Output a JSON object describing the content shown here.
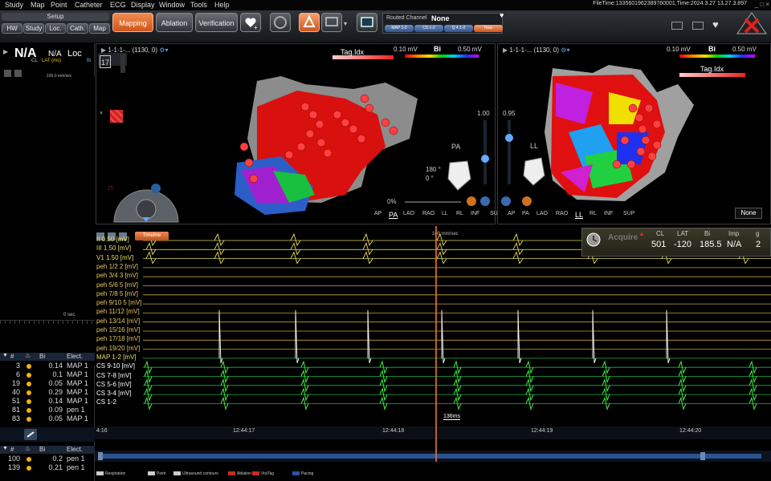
{
  "menu": [
    "Study",
    "Map",
    "Point",
    "Catheter",
    "ECG",
    "Display",
    "Window",
    "Tools",
    "Help"
  ],
  "file_time": "FileTime:1335601962389760001,Time:2024.3.27 13.27.3.897",
  "window_controls": [
    "_",
    "□",
    "×"
  ],
  "toolbar": {
    "setup_label": "Setup",
    "setup_tabs": [
      "HW",
      "Study",
      "Loc.",
      "Cath.",
      "Map"
    ],
    "mapping": "Mapping",
    "ablation": "Ablation",
    "verification": "Verification",
    "routed_channel_label": "Routed Channel",
    "routed_channel_value": "None",
    "routed_channels": [
      "MAP 1-2",
      "CS 1-2",
      "Q 4 1-2",
      "Now"
    ]
  },
  "left": {
    "cl": "N/A",
    "lat": "N/A",
    "loc": "Loc",
    "cl_label": "CL",
    "lat_label": "LAT (ms)",
    "bi_label": "Bi",
    "speed": "100.0 mm/sec",
    "zero": "0 sec",
    "points_header": {
      "c1": "#",
      "c2": "Bi",
      "c3": "Elect."
    },
    "points": [
      {
        "id": "3",
        "bi": "0.14",
        "el": "MAP 1"
      },
      {
        "id": "6",
        "bi": "0.1",
        "el": "MAP 1"
      },
      {
        "id": "19",
        "bi": "0.05",
        "el": "MAP 1"
      },
      {
        "id": "40",
        "bi": "0.29",
        "el": "MAP 1"
      },
      {
        "id": "51",
        "bi": "0.14",
        "el": "MAP 1"
      },
      {
        "id": "81",
        "bi": "0.09",
        "el": "pen 1"
      },
      {
        "id": "83",
        "bi": "0.05",
        "el": "MAP 1"
      }
    ],
    "points2": [
      {
        "id": "100",
        "bi": "0.2",
        "el": "pen 1"
      },
      {
        "id": "139",
        "bi": "0.21",
        "el": "pen 1"
      }
    ],
    "badge": "17"
  },
  "map1": {
    "title": "1-1-1-... (1130, 0)",
    "tag_label": "Tag.Idx",
    "scale_min": "0.10 mV",
    "scale_name": "Bi",
    "scale_max": "0.50 mV",
    "view_label": "PA",
    "rot1": "180 °",
    "rot2": "0 °",
    "opacity": "1.00",
    "percent": "0%",
    "views": [
      "AP",
      "PA",
      "LAO",
      "RAO",
      "LL",
      "RL",
      "INF",
      "SUP"
    ],
    "active_view": "PA"
  },
  "map2": {
    "title": "1-1-1-... (1130, 0)",
    "tag_label": "Tag.Idx",
    "scale_min": "0.10 mV",
    "scale_name": "Bi",
    "scale_max": "0.50 mV",
    "view_label": "LL",
    "opacity": "0.95",
    "views": [
      "AP",
      "PA",
      "LAO",
      "RAO",
      "LL",
      "RL",
      "INF",
      "SUP"
    ],
    "active_view": "LL",
    "none_btn": "None"
  },
  "egm": {
    "timeline_btn": "Timeline",
    "speed": "100 mm/sec",
    "measure": "136ms",
    "channels": [
      {
        "name": "II 0.50 [mV]",
        "color": "#e8e060"
      },
      {
        "name": "III 1.50 [mV]",
        "color": "#e8e060"
      },
      {
        "name": "V1 1.50 [mV]",
        "color": "#e8e060"
      },
      {
        "name": "peh 1/2 2 [mV]",
        "color": "#e8c860"
      },
      {
        "name": "peh 3/4 3 [mV]",
        "color": "#e8c860"
      },
      {
        "name": "peh 5/6 5 [mV]",
        "color": "#e8c860"
      },
      {
        "name": "peh 7/8 5 [mV]",
        "color": "#e8c860"
      },
      {
        "name": "peh 9/10 5 [mV]",
        "color": "#e8c860"
      },
      {
        "name": "peh 11/12 [mV]",
        "color": "#e8c860"
      },
      {
        "name": "peh 13/14 [mV]",
        "color": "#e8c860"
      },
      {
        "name": "peh 15/16 [mV]",
        "color": "#e8c860"
      },
      {
        "name": "peh 17/18 [mV]",
        "color": "#e8c860"
      },
      {
        "name": "peh 19/20 [mV]",
        "color": "#e8c860"
      },
      {
        "name": "MAP 1-2 [mV]",
        "color": "#e8e060"
      },
      {
        "name": "CS 9-10 [mV]",
        "color": "#ffffff"
      },
      {
        "name": "CS 7-8 [mV]",
        "color": "#ffffff"
      },
      {
        "name": "CS 5-6 [mV]",
        "color": "#ffffff"
      },
      {
        "name": "CS 3-4 [mV]",
        "color": "#ffffff"
      },
      {
        "name": "CS 1-2",
        "color": "#ffffff"
      }
    ],
    "info_headers": [
      "CL",
      "LAT",
      "Bi",
      "Imp",
      "g"
    ],
    "info_values": [
      "501",
      "-120",
      "185.5",
      "N/A",
      "2"
    ],
    "acquire": "Acquire"
  },
  "timeaxis": [
    "4:16",
    "12:44:17",
    "12:44:18",
    "12:44:19",
    "12:44:20"
  ],
  "legend": [
    {
      "label": "Respiration",
      "color": "#cccccc"
    },
    {
      "label": "Point",
      "color": "#cccccc"
    },
    {
      "label": "Ultrasound contours",
      "color": "#cccccc"
    },
    {
      "label": "Ablation",
      "color": "#c03020"
    },
    {
      "label": "VisiTag",
      "color": "#c03020"
    },
    {
      "label": "Pacing",
      "color": "#3050a0"
    }
  ]
}
